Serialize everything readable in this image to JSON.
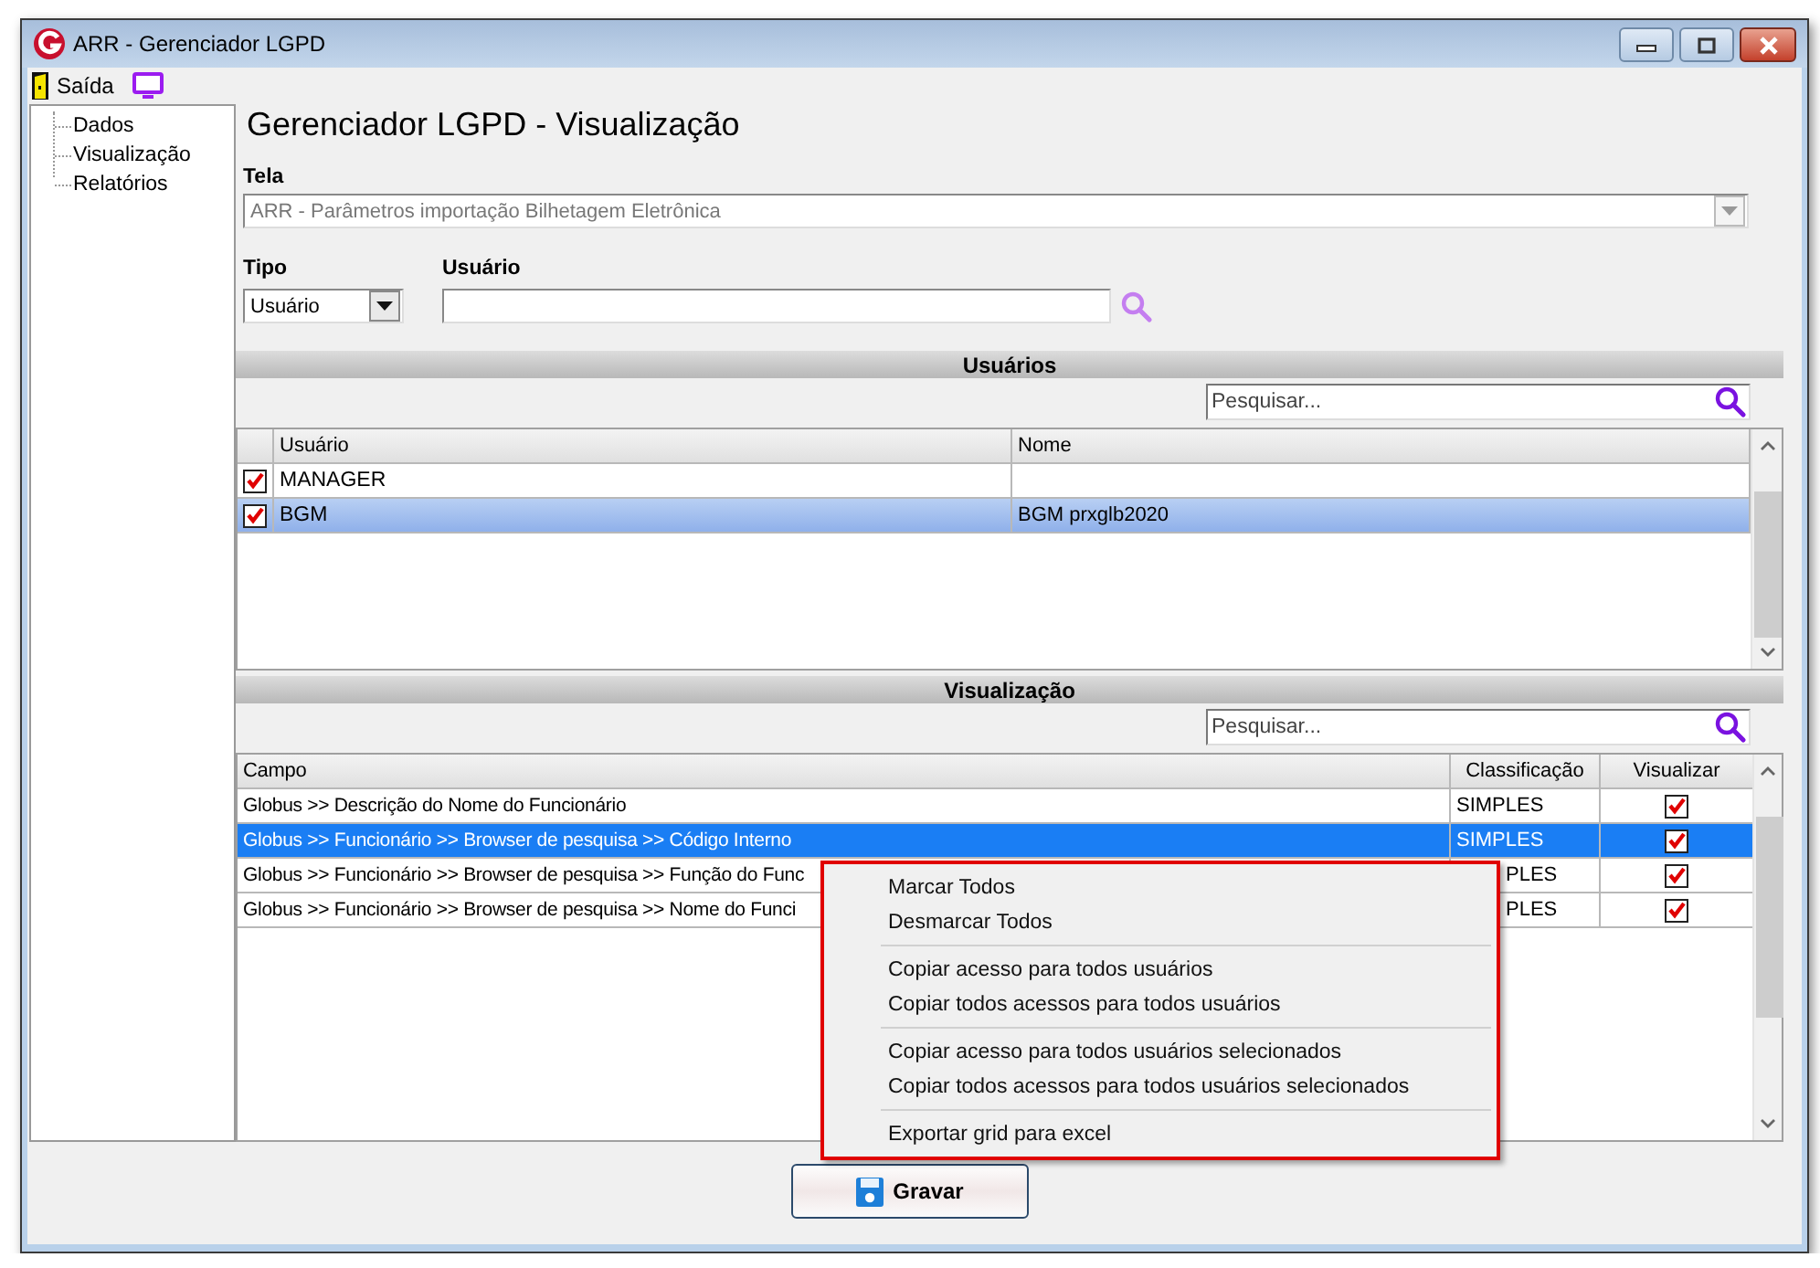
{
  "window": {
    "title": "ARR - Gerenciador LGPD"
  },
  "toolbar": {
    "items": [
      {
        "label": "Saída"
      }
    ]
  },
  "tree": {
    "items": [
      {
        "label": "Dados"
      },
      {
        "label": "Visualização"
      },
      {
        "label": "Relatórios"
      }
    ]
  },
  "page_title": "Gerenciador LGPD - Visualização",
  "tela": {
    "label": "Tela",
    "value": "ARR - Parâmetros importação Bilhetagem Eletrônica",
    "disabled": true
  },
  "tipo": {
    "label": "Tipo",
    "value": "Usuário"
  },
  "usuario": {
    "label": "Usuário"
  },
  "usuarios": {
    "title": "Usuários",
    "search": {
      "placeholder": "Pesquisar..."
    },
    "columns": [
      "Usuário",
      "Nome"
    ],
    "rows": [
      {
        "checked": true,
        "selected": false,
        "usuario": "MANAGER"
      },
      {
        "checked": true,
        "selected": true,
        "usuario": "BGM",
        "nome": "BGM prxglb2020"
      }
    ]
  },
  "visualizacao": {
    "title": "Visualização",
    "search": {
      "placeholder": "Pesquisar..."
    },
    "columns": [
      "Campo",
      "Classificação",
      "Visualizar"
    ],
    "rows": [
      {
        "selected": false,
        "campo": "Globus >> Descrição do Nome do Funcionário",
        "classificacao": "SIMPLES",
        "visualizar": true
      },
      {
        "selected": true,
        "campo": "Globus >> Funcionário >> Browser de pesquisa >> Código Interno",
        "classificacao": "SIMPLES",
        "visualizar": true
      },
      {
        "selected": false,
        "campo": "Globus >> Funcionário >> Browser de pesquisa >> Função do Func",
        "classificacao": "PLES",
        "visualizar": true
      },
      {
        "selected": false,
        "campo": "Globus >> Funcionário >> Browser de pesquisa >> Nome do Funci",
        "classificacao": "PLES",
        "visualizar": true
      }
    ]
  },
  "context_menu": {
    "items": [
      {
        "kind": "item",
        "label": "Marcar Todos"
      },
      {
        "kind": "item",
        "label": "Desmarcar Todos"
      },
      {
        "kind": "separator"
      },
      {
        "kind": "item",
        "label": "Copiar acesso para todos usuários"
      },
      {
        "kind": "item",
        "label": "Copiar todos acessos para todos usuários"
      },
      {
        "kind": "separator"
      },
      {
        "kind": "item",
        "label": "Copiar acesso para todos usuários selecionados"
      },
      {
        "kind": "item",
        "label": "Copiar todos acessos para todos usuários selecionados"
      },
      {
        "kind": "separator"
      },
      {
        "kind": "item",
        "label": "Exportar grid para excel"
      }
    ]
  },
  "save_button": {
    "label": "Gravar"
  }
}
